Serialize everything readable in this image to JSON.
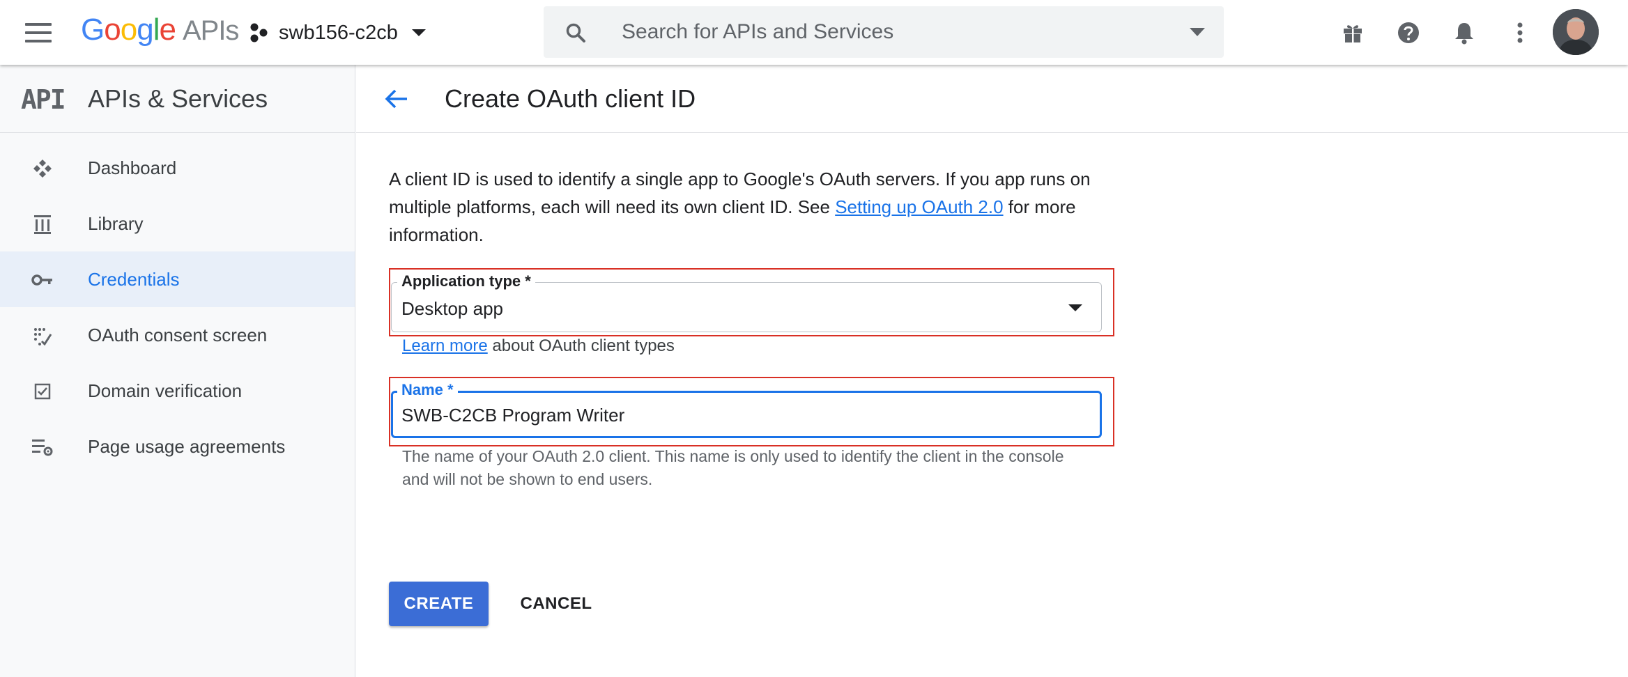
{
  "header": {
    "logo_google": [
      "G",
      "o",
      "o",
      "g",
      "l",
      "e"
    ],
    "logo_apis": "APIs",
    "project_name": "swb156-c2cb",
    "search_placeholder": "Search for APIs and Services",
    "icons": [
      "menu-icon",
      "project-icon",
      "search-icon",
      "gift-icon",
      "help-icon",
      "notifications-icon",
      "more-vert-icon",
      "avatar"
    ]
  },
  "sidebar": {
    "title": "APIs & Services",
    "logo_text": "API",
    "items": [
      {
        "label": "Dashboard",
        "icon": "dashboard-icon",
        "active": false
      },
      {
        "label": "Library",
        "icon": "library-icon",
        "active": false
      },
      {
        "label": "Credentials",
        "icon": "key-icon",
        "active": true
      },
      {
        "label": "OAuth consent screen",
        "icon": "consent-icon",
        "active": false
      },
      {
        "label": "Domain verification",
        "icon": "checkbox-icon",
        "active": false
      },
      {
        "label": "Page usage agreements",
        "icon": "settings-list-icon",
        "active": false
      }
    ]
  },
  "main": {
    "title": "Create OAuth client ID",
    "description_1": "A client ID is used to identify a single app to Google's OAuth servers. If you app runs on multiple platforms, each will need its own client ID. See ",
    "description_link": "Setting up OAuth 2.0",
    "description_2": " for more information.",
    "application_type": {
      "label": "Application type *",
      "value": "Desktop app"
    },
    "learn_more_link": "Learn more",
    "learn_more_text": " about OAuth client types",
    "name_field": {
      "label": "Name *",
      "value": "SWB-C2CB Program Writer"
    },
    "name_hint": "The name of your OAuth 2.0 client. This name is only used to identify the client in the console and will not be shown to end users.",
    "create_label": "CREATE",
    "cancel_label": "CANCEL"
  },
  "colors": {
    "accent": "#1a73e8",
    "create_button": "#3b6dd6",
    "highlight_border": "#d93025",
    "active_nav_bg": "#e8eff9"
  }
}
